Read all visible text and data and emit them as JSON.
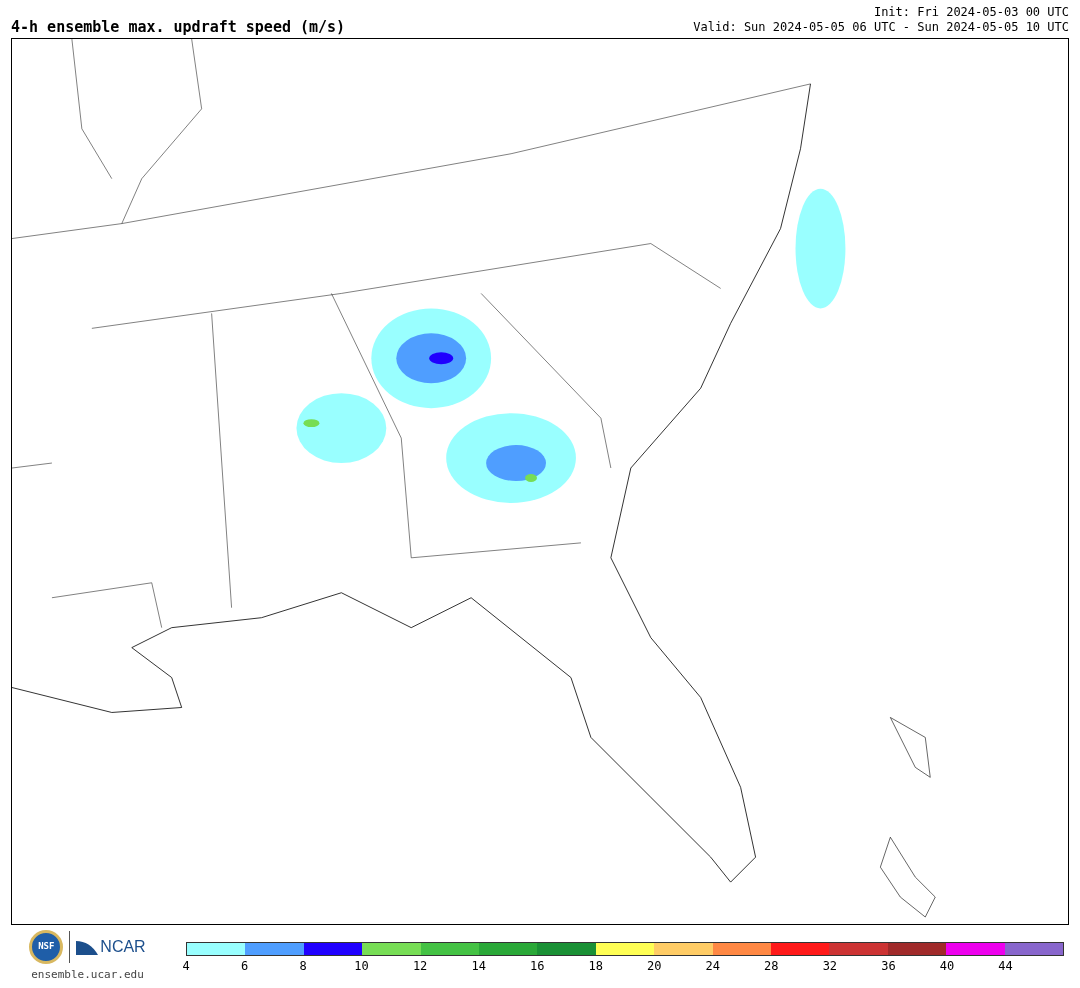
{
  "title": "4-h ensemble max. updraft speed (m/s)",
  "init": "Init: Fri 2024-05-03 00 UTC",
  "valid": "Valid: Sun 2024-05-05 06 UTC - Sun 2024-05-05 10 UTC",
  "logos": {
    "nsf": "NSF",
    "ncar": "NCAR",
    "url": "ensemble.ucar.edu"
  },
  "colorbar": {
    "bins": [
      {
        "color": "#99ffff"
      },
      {
        "color": "#4f9eff"
      },
      {
        "color": "#2000ff"
      },
      {
        "color": "#77dd55"
      },
      {
        "color": "#44c244"
      },
      {
        "color": "#2aa838"
      },
      {
        "color": "#1a9035"
      },
      {
        "color": "#ffff55"
      },
      {
        "color": "#ffcc66"
      },
      {
        "color": "#ff8844"
      },
      {
        "color": "#ff1a1a"
      },
      {
        "color": "#cc3333"
      },
      {
        "color": "#a02a2a"
      },
      {
        "color": "#ee00ee"
      },
      {
        "color": "#8866cc"
      }
    ],
    "ticks": [
      "4",
      "6",
      "8",
      "10",
      "12",
      "14",
      "16",
      "18",
      "20",
      "24",
      "28",
      "32",
      "36",
      "40",
      "44"
    ]
  }
}
